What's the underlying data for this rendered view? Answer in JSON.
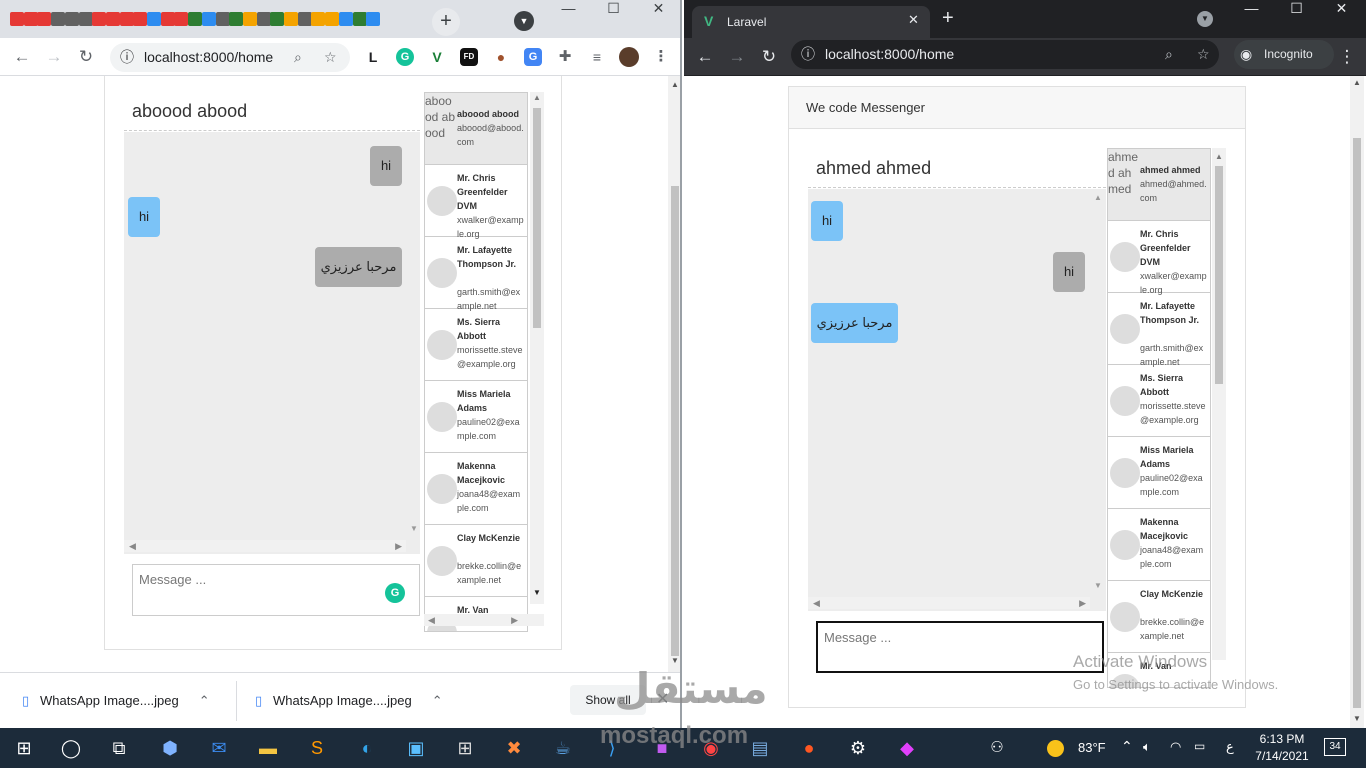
{
  "left_window": {
    "tab_favicons": [
      "red",
      "red",
      "red",
      "gray",
      "gray",
      "gray",
      "red",
      "red",
      "red",
      "red",
      "blue",
      "red",
      "red",
      "green",
      "blue",
      "gray",
      "green",
      "orange",
      "gray",
      "green",
      "orange",
      "gray",
      "orange",
      "orange",
      "blue",
      "green",
      "blue"
    ],
    "new_tab_label": "+",
    "address": "localhost:8000/home",
    "profile_ext_label": "L",
    "card": {
      "chat_title": "aboood abood",
      "messages": [
        {
          "text": "hi",
          "side": "right"
        },
        {
          "text": "hi",
          "side": "left"
        },
        {
          "text": "مرحبا عرزيزي",
          "side": "right"
        }
      ],
      "input_placeholder": "Message ...",
      "users": [
        {
          "alt": "aboood abood",
          "name": "aboood abood",
          "email": "aboood@abood.com",
          "active": true
        },
        {
          "name": "Mr. Chris Greenfelder DVM",
          "email": "xwalker@example.org"
        },
        {
          "name": "Mr. Lafayette Thompson Jr.",
          "email": "garth.smith@example.net"
        },
        {
          "name": "Ms. Sierra Abbott",
          "email": "morissette.steve@example.org"
        },
        {
          "name": "Miss Mariela Adams",
          "email": "pauline02@example.com"
        },
        {
          "name": "Makenna Macejkovic",
          "email": "joana48@example.com"
        },
        {
          "name": "Clay McKenzie",
          "email": "brekke.collin@example.net"
        },
        {
          "name": "Mr. Van",
          "email": ""
        }
      ]
    },
    "downloads": [
      {
        "name": "WhatsApp Image....jpeg"
      },
      {
        "name": "WhatsApp Image....jpeg"
      }
    ],
    "show_all": "Show all"
  },
  "right_window": {
    "tab_title": "Laravel",
    "address": "localhost:8000/home",
    "incognito_label": "Incognito",
    "card_header": "We code Messenger",
    "card": {
      "chat_title": "ahmed ahmed",
      "messages": [
        {
          "text": "hi",
          "side": "left"
        },
        {
          "text": "hi",
          "side": "right"
        },
        {
          "text": "مرحبا عرزيزي",
          "side": "left"
        }
      ],
      "input_placeholder": "Message ...",
      "users": [
        {
          "alt": "ahmed ahmed",
          "name": "ahmed ahmed",
          "email": "ahmed@ahmed.com",
          "active": true
        },
        {
          "name": "Mr. Chris Greenfelder DVM",
          "email": "xwalker@example.org"
        },
        {
          "name": "Mr. Lafayette Thompson Jr.",
          "email": "garth.smith@example.net"
        },
        {
          "name": "Ms. Sierra Abbott",
          "email": "morissette.steve@example.org"
        },
        {
          "name": "Miss Mariela Adams",
          "email": "pauline02@example.com"
        },
        {
          "name": "Makenna Macejkovic",
          "email": "joana48@example.com"
        },
        {
          "name": "Clay McKenzie",
          "email": "brekke.collin@example.net"
        },
        {
          "name": "Mr. Van",
          "email": ""
        }
      ]
    },
    "activation_title": "Activate Windows",
    "activation_sub": "Go to Settings to activate Windows."
  },
  "taskbar": {
    "temperature": "83°F",
    "time": "6:13 PM",
    "date": "7/14/2021",
    "lang": "ع",
    "notifications": "34"
  },
  "watermark": {
    "arabic": "مستقل",
    "latin": "mostaql.com"
  }
}
